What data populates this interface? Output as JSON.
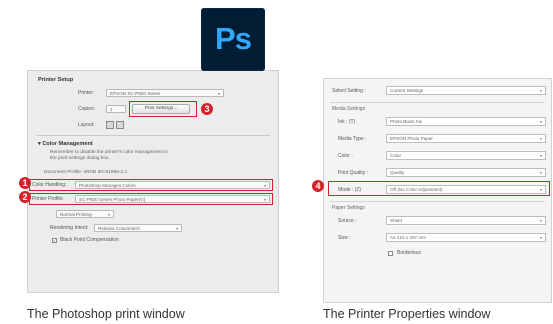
{
  "photoshop_window": {
    "printer_setup": {
      "title": "Printer Setup",
      "printer_label": "Printer:",
      "printer_value": "EPSON SC-P600 Series",
      "copies_label": "Copies:",
      "copies_value": "1",
      "print_settings_button": "Print Settings...",
      "layout_label": "Layout:"
    },
    "color_management": {
      "title": "Color Management",
      "note": "Remember to disable the printer's color management in the print settings dialog box.",
      "document_profile": "Document Profile: sRGB IEC61966-2.1",
      "color_handling_label": "Color Handling:",
      "color_handling_value": "Photoshop Manages Colors",
      "printer_profile_label": "Printer Profile:",
      "printer_profile_value": "SC-P600 Series Photo Paper(G)",
      "print_mode_value": "Normal Printing",
      "rendering_intent_label": "Rendering Intent:",
      "rendering_intent_value": "Relative Colorimetric",
      "bpc_label": "Black Point Compensation"
    },
    "badges": [
      "1",
      "2",
      "3"
    ],
    "logo_text": "Ps"
  },
  "printer_properties": {
    "select_setting_label": "Select Setting :",
    "select_setting_value": "Current Settings",
    "media_settings_title": "Media Settings",
    "ink_label": "Ink : (T)",
    "ink_value": "Photo Black Ink",
    "media_type_label": "Media Type :",
    "media_type_value": "EPSON Photo Paper",
    "color_label": "Color :",
    "color_value": "Color",
    "print_quality_label": "Print Quality :",
    "print_quality_value": "Quality",
    "mode_label": "Mode : (Z)",
    "mode_value": "Off (No Color Adjustment)",
    "paper_settings_title": "Paper Settings",
    "source_label": "Source :",
    "source_value": "Sheet",
    "size_label": "Size :",
    "size_value": "A4 210 x 297 mm",
    "borderless_label": "Borderless",
    "badge": "4"
  },
  "captions": {
    "left": "The Photoshop print window",
    "right": "The Printer Properties window"
  },
  "colors": {
    "highlight": "#d2232a",
    "ps_logo_bg": "#001d34",
    "ps_logo_text": "#31a8ff"
  }
}
